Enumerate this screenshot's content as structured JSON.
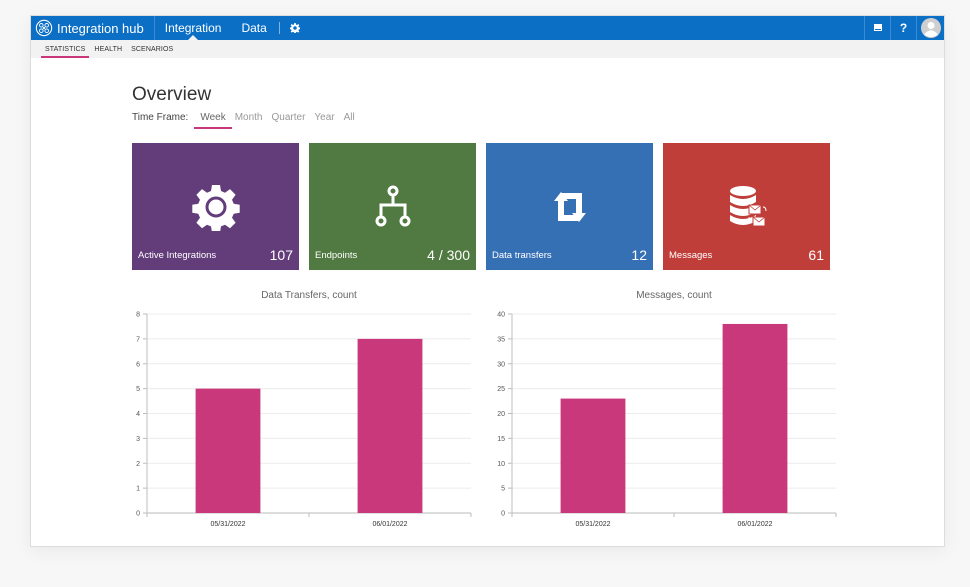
{
  "topbar": {
    "app_title": "Integration hub",
    "nav": [
      {
        "label": "Integration",
        "active": true
      },
      {
        "label": "Data",
        "active": false
      }
    ],
    "settings_icon": "gear-icon",
    "right_icons": [
      "notes-icon",
      "help-icon",
      "user-avatar-icon"
    ],
    "help_label": "?"
  },
  "subnav": {
    "items": [
      {
        "label": "STATISTICS",
        "active": true
      },
      {
        "label": "HEALTH",
        "active": false
      },
      {
        "label": "SCENARIOS",
        "active": false
      }
    ]
  },
  "overview": {
    "title": "Overview",
    "timeframe_label": "Time Frame:",
    "timeframe_options": [
      {
        "label": "Week",
        "active": true
      },
      {
        "label": "Month",
        "active": false
      },
      {
        "label": "Quarter",
        "active": false
      },
      {
        "label": "Year",
        "active": false
      },
      {
        "label": "All",
        "active": false
      }
    ]
  },
  "tiles": [
    {
      "label": "Active Integrations",
      "value": "107",
      "icon": "gear-icon",
      "color": "#633c7a"
    },
    {
      "label": "Endpoints",
      "value": "4 / 300",
      "icon": "hierarchy-icon",
      "color": "#507a42"
    },
    {
      "label": "Data transfers",
      "value": "12",
      "icon": "retweet-icon",
      "color": "#3570b4"
    },
    {
      "label": "Messages",
      "value": "61",
      "icon": "database-mail-icon",
      "color": "#c03e39"
    }
  ],
  "colors": {
    "accent": "#c9387a",
    "topbar": "#0b6fc6",
    "bar": "#c9387a"
  },
  "chart_data": [
    {
      "type": "bar",
      "title": "Data Transfers, count",
      "categories": [
        "05/31/2022",
        "06/01/2022"
      ],
      "values": [
        5,
        7
      ],
      "xlabel": "",
      "ylabel": "",
      "ylim": [
        0,
        8
      ],
      "yticks": [
        0,
        1,
        2,
        3,
        4,
        5,
        6,
        7,
        8
      ],
      "grid": true,
      "legend": "none"
    },
    {
      "type": "bar",
      "title": "Messages, count",
      "categories": [
        "05/31/2022",
        "06/01/2022"
      ],
      "values": [
        23,
        38
      ],
      "xlabel": "",
      "ylabel": "",
      "ylim": [
        0,
        40
      ],
      "yticks": [
        0,
        5,
        10,
        15,
        20,
        25,
        30,
        35,
        40
      ],
      "grid": true,
      "legend": "none"
    }
  ]
}
